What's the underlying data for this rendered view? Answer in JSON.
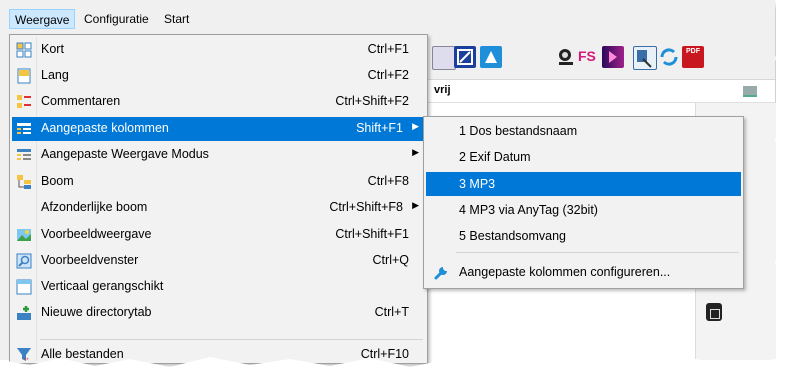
{
  "colors": {
    "menu_background": "#f2f2f2",
    "highlight": "#0078d7",
    "menubar_open": "#cce8ff"
  },
  "menubar": {
    "items": [
      {
        "label": "Weergave",
        "open": true
      },
      {
        "label": "Configuratie",
        "open": false
      },
      {
        "label": "Start",
        "open": false
      }
    ]
  },
  "toolbar": {
    "fs_label": "FS",
    "pdf_label": "PDF"
  },
  "addressbar": {
    "text": "vrij"
  },
  "view_menu": {
    "items": [
      {
        "label": "Kort",
        "shortcut": "Ctrl+F1",
        "icon": "short-view-icon"
      },
      {
        "label": "Lang",
        "shortcut": "Ctrl+F2",
        "icon": "long-view-icon"
      },
      {
        "label": "Commentaren",
        "shortcut": "Ctrl+Shift+F2",
        "icon": "comments-view-icon"
      },
      {
        "label": "Aangepaste kolommen",
        "shortcut": "Shift+F1",
        "icon": "custom-columns-icon",
        "submenu": true,
        "highlighted": true
      },
      {
        "label": "Aangepaste Weergave Modus",
        "shortcut": "",
        "icon": "custom-view-mode-icon",
        "submenu": true
      },
      {
        "label": "Boom",
        "shortcut": "Ctrl+F8",
        "icon": "tree-icon"
      },
      {
        "label": "Afzonderlijke boom",
        "shortcut": "Ctrl+Shift+F8",
        "icon": "",
        "submenu": true
      },
      {
        "label": "Voorbeeldweergave",
        "shortcut": "Ctrl+Shift+F1",
        "icon": "thumbnail-view-icon"
      },
      {
        "label": "Voorbeeldvenster",
        "shortcut": "Ctrl+Q",
        "icon": "preview-window-icon"
      },
      {
        "label": "Verticaal gerangschikt",
        "shortcut": "",
        "icon": "vertical-arrangement-icon"
      },
      {
        "label": "Nieuwe directorytab",
        "shortcut": "Ctrl+T",
        "icon": "new-tab-icon"
      },
      {
        "label": "Alle bestanden",
        "shortcut": "Ctrl+F10",
        "icon": "all-files-filter-icon"
      }
    ]
  },
  "columns_submenu": {
    "items": [
      {
        "label": "1 Dos bestandsnaam"
      },
      {
        "label": "2 Exif Datum"
      },
      {
        "label": "3 MP3",
        "highlighted": true
      },
      {
        "label": "4 MP3 via AnyTag (32bit)"
      },
      {
        "label": "5 Bestandsomvang"
      },
      {
        "label": "Aangepaste kolommen configureren...",
        "icon": "wrench-icon"
      }
    ]
  }
}
